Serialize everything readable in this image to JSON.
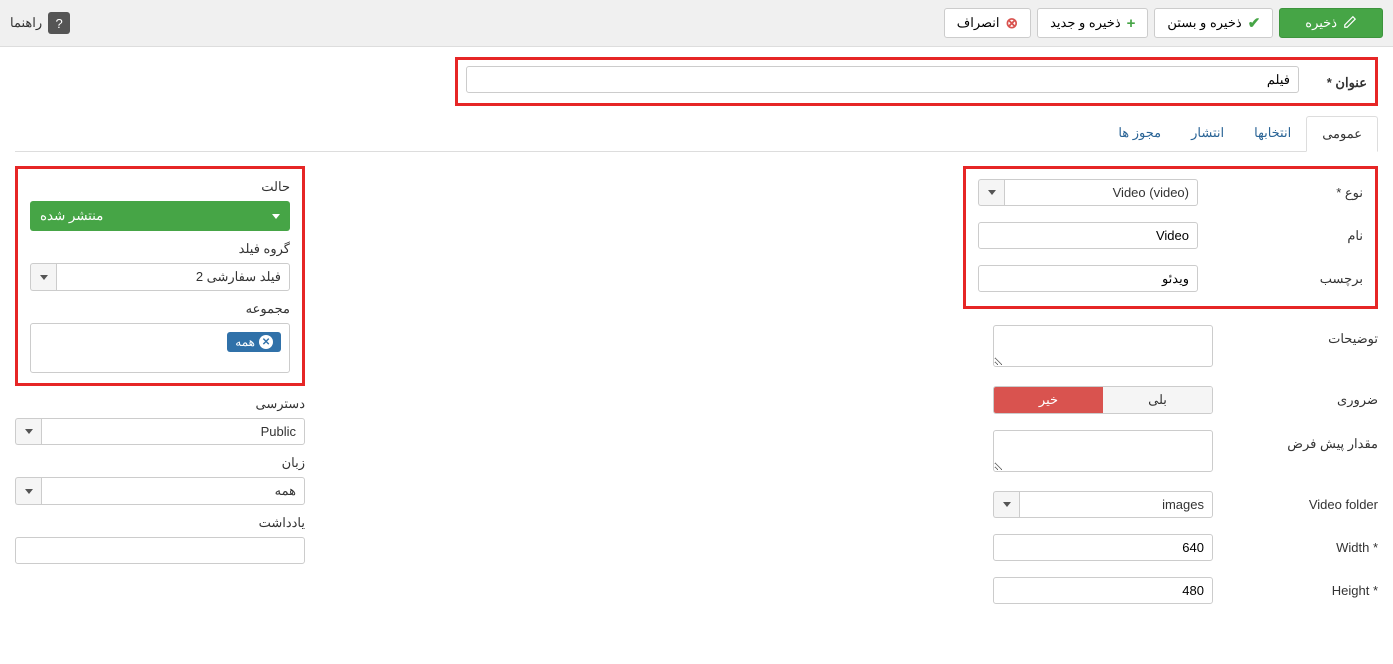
{
  "toolbar": {
    "save": "ذخیره",
    "save_close": "ذخیره و بستن",
    "save_new": "ذخیره و جدید",
    "cancel": "انصراف",
    "help": "راهنما"
  },
  "title": {
    "label": "عنوان *",
    "value": "فیلم"
  },
  "tabs": {
    "general": "عمومی",
    "options": "انتخابها",
    "publish": "انتشار",
    "permissions": "مجوز ها"
  },
  "fields": {
    "type_label": "نوع *",
    "type_value": "Video (video)",
    "name_label": "نام",
    "name_value": "Video",
    "tag_label": "برچسب",
    "tag_value": "ویدئو",
    "desc_label": "توضیحات",
    "desc_value": "",
    "required_label": "ضروری",
    "required_yes": "بلی",
    "required_no": "خیر",
    "default_label": "مقدار پیش فرض",
    "default_value": "",
    "folder_label": "Video folder",
    "folder_value": "images",
    "width_label": "* Width",
    "width_value": "640",
    "height_label": "* Height",
    "height_value": "480"
  },
  "side": {
    "status_label": "حالت",
    "status_value": "منتشر شده",
    "group_label": "گروه فیلد",
    "group_value": "فیلد سفارشی 2",
    "collection_label": "مجموعه",
    "collection_tag": "همه",
    "access_label": "دسترسی",
    "access_value": "Public",
    "lang_label": "زبان",
    "lang_value": "همه",
    "note_label": "یادداشت",
    "note_value": ""
  }
}
